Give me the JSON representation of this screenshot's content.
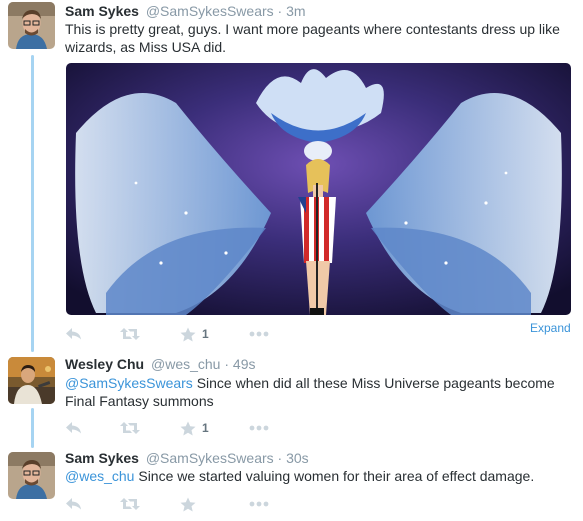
{
  "tweets": [
    {
      "name": "Sam Sykes",
      "handle": "@SamSykesSwears",
      "separator": "·",
      "time": "3m",
      "text": "This is pretty great, guys.  I want more pageants where contestants dress up like wizards, as Miss USA did.",
      "expand_label": "Expand",
      "favorites": "1"
    },
    {
      "name": "Wesley Chu",
      "handle": "@wes_chu",
      "separator": "·",
      "time": "49s",
      "mention": "@SamSykesSwears",
      "text": " Since when did all these Miss Universe pageants become Final Fantasy summons",
      "favorites": "1"
    },
    {
      "name": "Sam Sykes",
      "handle": "@SamSykesSwears",
      "separator": "·",
      "time": "30s",
      "mention": "@wes_chu",
      "text": " Since we started valuing women for their area of effect damage."
    }
  ],
  "icons": {
    "reply": "reply-icon",
    "retweet": "retweet-icon",
    "favorite": "star-icon",
    "more": "more-icon"
  },
  "colors": {
    "link": "#3b94d9",
    "thread_line": "#a6d4f2",
    "icon": "#ccd6dd"
  }
}
